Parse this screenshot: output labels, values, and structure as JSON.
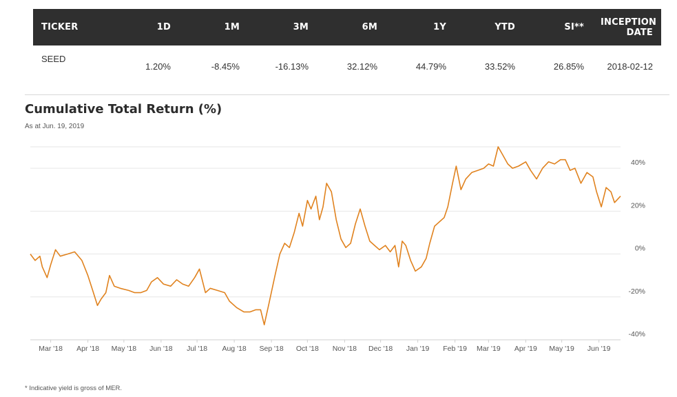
{
  "table": {
    "headers": [
      "TICKER",
      "1D",
      "1M",
      "3M",
      "6M",
      "1Y",
      "YTD",
      "SI**",
      "INCEPTION DATE"
    ],
    "rows": [
      [
        "SEED",
        "1.20%",
        "-8.45%",
        "-16.13%",
        "32.12%",
        "44.79%",
        "33.52%",
        "26.85%",
        "2018-02-12"
      ]
    ]
  },
  "chart_title": "Cumulative Total Return (%)",
  "chart_subtitle": "As at Jun. 19, 2019",
  "footnote": "* Indicative yield is gross of MER.",
  "colors": {
    "line": "#e0821e",
    "header_bg": "#2f2f2f",
    "grid": "#e6e6e6"
  },
  "chart_data": {
    "type": "line",
    "title": "Cumulative Total Return (%)",
    "subtitle": "As at Jun. 19, 2019",
    "xlabel": "",
    "ylabel": "",
    "ylim": [
      -40,
      50
    ],
    "xlim": [
      "2018-02-12",
      "2019-06-19"
    ],
    "grid": true,
    "y_axis_position": "right",
    "y_ticks": [
      {
        "value": 40,
        "label": "40%"
      },
      {
        "value": 20,
        "label": "20%"
      },
      {
        "value": 0,
        "label": "0%"
      },
      {
        "value": -20,
        "label": "-20%"
      },
      {
        "value": -40,
        "label": "-40%"
      }
    ],
    "x_ticks": [
      {
        "date": "2018-03-01",
        "label": "Mar '18"
      },
      {
        "date": "2018-04-01",
        "label": "Apr '18"
      },
      {
        "date": "2018-05-01",
        "label": "May '18"
      },
      {
        "date": "2018-06-01",
        "label": "Jun '18"
      },
      {
        "date": "2018-07-01",
        "label": "Jul '18"
      },
      {
        "date": "2018-08-01",
        "label": "Aug '18"
      },
      {
        "date": "2018-09-01",
        "label": "Sep '18"
      },
      {
        "date": "2018-10-01",
        "label": "Oct '18"
      },
      {
        "date": "2018-11-01",
        "label": "Nov '18"
      },
      {
        "date": "2018-12-01",
        "label": "Dec '18"
      },
      {
        "date": "2019-01-01",
        "label": "Jan '19"
      },
      {
        "date": "2019-02-01",
        "label": "Feb '19"
      },
      {
        "date": "2019-03-01",
        "label": "Mar '19"
      },
      {
        "date": "2019-04-01",
        "label": "Apr '19"
      },
      {
        "date": "2019-05-01",
        "label": "May '19"
      },
      {
        "date": "2019-06-01",
        "label": "Jun '19"
      }
    ],
    "series": [
      {
        "name": "",
        "points": [
          [
            "2018-02-12",
            0
          ],
          [
            "2018-02-16",
            -3
          ],
          [
            "2018-02-20",
            -1
          ],
          [
            "2018-02-22",
            -6
          ],
          [
            "2018-02-26",
            -11
          ],
          [
            "2018-03-01",
            -5
          ],
          [
            "2018-03-05",
            2
          ],
          [
            "2018-03-09",
            -1
          ],
          [
            "2018-03-15",
            0
          ],
          [
            "2018-03-21",
            1
          ],
          [
            "2018-03-27",
            -3
          ],
          [
            "2018-04-01",
            -10
          ],
          [
            "2018-04-05",
            -17
          ],
          [
            "2018-04-09",
            -24
          ],
          [
            "2018-04-12",
            -21
          ],
          [
            "2018-04-16",
            -18
          ],
          [
            "2018-04-19",
            -10
          ],
          [
            "2018-04-23",
            -15
          ],
          [
            "2018-04-28",
            -16
          ],
          [
            "2018-05-05",
            -17
          ],
          [
            "2018-05-10",
            -18
          ],
          [
            "2018-05-15",
            -18
          ],
          [
            "2018-05-20",
            -17
          ],
          [
            "2018-05-24",
            -13
          ],
          [
            "2018-05-29",
            -11
          ],
          [
            "2018-06-03",
            -14
          ],
          [
            "2018-06-09",
            -15
          ],
          [
            "2018-06-14",
            -12
          ],
          [
            "2018-06-19",
            -14
          ],
          [
            "2018-06-24",
            -15
          ],
          [
            "2018-06-29",
            -11
          ],
          [
            "2018-07-03",
            -7
          ],
          [
            "2018-07-08",
            -18
          ],
          [
            "2018-07-12",
            -16
          ],
          [
            "2018-07-18",
            -17
          ],
          [
            "2018-07-24",
            -18
          ],
          [
            "2018-07-28",
            -22
          ],
          [
            "2018-08-03",
            -25
          ],
          [
            "2018-08-09",
            -27
          ],
          [
            "2018-08-14",
            -27
          ],
          [
            "2018-08-19",
            -26
          ],
          [
            "2018-08-23",
            -26
          ],
          [
            "2018-08-26",
            -33
          ],
          [
            "2018-08-30",
            -23
          ],
          [
            "2018-09-04",
            -10
          ],
          [
            "2018-09-08",
            0
          ],
          [
            "2018-09-12",
            5
          ],
          [
            "2018-09-16",
            3
          ],
          [
            "2018-09-20",
            10
          ],
          [
            "2018-09-24",
            19
          ],
          [
            "2018-09-27",
            13
          ],
          [
            "2018-10-01",
            25
          ],
          [
            "2018-10-04",
            21
          ],
          [
            "2018-10-08",
            27
          ],
          [
            "2018-10-11",
            16
          ],
          [
            "2018-10-14",
            22
          ],
          [
            "2018-10-17",
            33
          ],
          [
            "2018-10-21",
            29
          ],
          [
            "2018-10-25",
            16
          ],
          [
            "2018-10-29",
            7
          ],
          [
            "2018-11-02",
            3
          ],
          [
            "2018-11-06",
            5
          ],
          [
            "2018-11-10",
            14
          ],
          [
            "2018-11-14",
            21
          ],
          [
            "2018-11-18",
            13
          ],
          [
            "2018-11-22",
            6
          ],
          [
            "2018-11-26",
            4
          ],
          [
            "2018-11-30",
            2
          ],
          [
            "2018-12-05",
            4
          ],
          [
            "2018-12-09",
            1
          ],
          [
            "2018-12-13",
            4
          ],
          [
            "2018-12-16",
            -6
          ],
          [
            "2018-12-19",
            6
          ],
          [
            "2018-12-22",
            4
          ],
          [
            "2018-12-26",
            -3
          ],
          [
            "2018-12-30",
            -8
          ],
          [
            "2019-01-04",
            -6
          ],
          [
            "2019-01-08",
            -2
          ],
          [
            "2019-01-11",
            5
          ],
          [
            "2019-01-15",
            13
          ],
          [
            "2019-01-19",
            15
          ],
          [
            "2019-01-23",
            17
          ],
          [
            "2019-01-26",
            22
          ],
          [
            "2019-01-30",
            33
          ],
          [
            "2019-02-02",
            41
          ],
          [
            "2019-02-06",
            30
          ],
          [
            "2019-02-10",
            35
          ],
          [
            "2019-02-15",
            38
          ],
          [
            "2019-02-20",
            39
          ],
          [
            "2019-02-25",
            40
          ],
          [
            "2019-03-01",
            42
          ],
          [
            "2019-03-05",
            41
          ],
          [
            "2019-03-09",
            50
          ],
          [
            "2019-03-13",
            46
          ],
          [
            "2019-03-17",
            42
          ],
          [
            "2019-03-21",
            40
          ],
          [
            "2019-03-26",
            41
          ],
          [
            "2019-04-01",
            43
          ],
          [
            "2019-04-05",
            39
          ],
          [
            "2019-04-10",
            35
          ],
          [
            "2019-04-15",
            40
          ],
          [
            "2019-04-20",
            43
          ],
          [
            "2019-04-25",
            42
          ],
          [
            "2019-04-30",
            44
          ],
          [
            "2019-05-04",
            44
          ],
          [
            "2019-05-08",
            39
          ],
          [
            "2019-05-12",
            40
          ],
          [
            "2019-05-17",
            33
          ],
          [
            "2019-05-22",
            38
          ],
          [
            "2019-05-27",
            36
          ],
          [
            "2019-05-30",
            29
          ],
          [
            "2019-06-03",
            22
          ],
          [
            "2019-06-07",
            31
          ],
          [
            "2019-06-11",
            29
          ],
          [
            "2019-06-14",
            24
          ],
          [
            "2019-06-19",
            27
          ]
        ]
      }
    ]
  }
}
